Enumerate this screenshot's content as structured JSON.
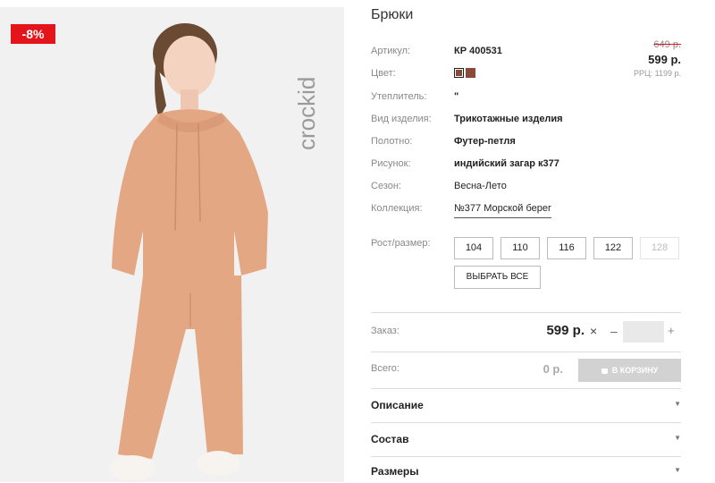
{
  "product": {
    "discount_badge": "-8%",
    "brand_logo_text": "crockid",
    "title": "Брюки"
  },
  "attributes": [
    {
      "label": "Артикул:",
      "value": "КР 400531"
    },
    {
      "label": "Цвет:",
      "value": ""
    },
    {
      "label": "Утеплитель:",
      "value": "\""
    },
    {
      "label": "Вид изделия:",
      "value": "Трикотажные изделия"
    },
    {
      "label": "Полотно:",
      "value": "Футер-петля"
    },
    {
      "label": "Рисунок:",
      "value": "индийский загар к377"
    },
    {
      "label": "Сезон:",
      "value": "Весна-Лето"
    },
    {
      "label": "Коллекция:",
      "value": "№377 Морской берег"
    }
  ],
  "colors": [
    "#8a4a37",
    "#8a4a37"
  ],
  "pricing": {
    "old_price": "649 р.",
    "price": "599 р.",
    "rrp": "РРЦ: 1199 р."
  },
  "sizes": {
    "label": "Рост/размер:",
    "options": [
      {
        "label": "104",
        "available": true
      },
      {
        "label": "110",
        "available": true
      },
      {
        "label": "116",
        "available": true
      },
      {
        "label": "122",
        "available": true
      },
      {
        "label": "128",
        "available": false
      }
    ],
    "select_all": "ВЫБРАТЬ ВСЕ"
  },
  "order": {
    "label": "Заказ:",
    "price": "599 р.",
    "times": "×",
    "minus": "–",
    "plus": "+",
    "quantity": ""
  },
  "total": {
    "label": "Всего:",
    "value": "0 р.",
    "cart_button": "В КОРЗИНУ"
  },
  "sections": [
    {
      "title": "Описание"
    },
    {
      "title": "Состав"
    },
    {
      "title": "Размеры"
    }
  ],
  "colors_ui": {
    "accent_red": "#e3151a",
    "cart_disabled": "#d2d2d2"
  }
}
